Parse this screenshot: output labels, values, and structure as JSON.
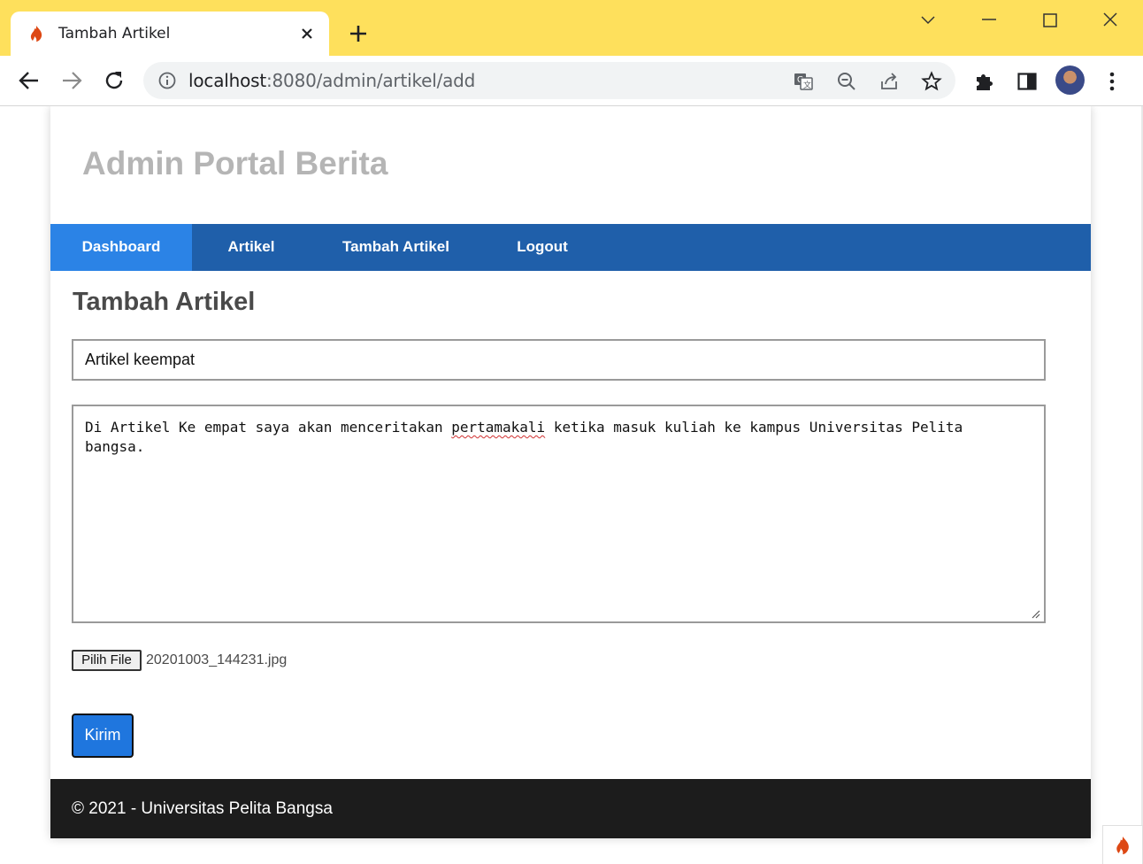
{
  "browser": {
    "tab_title": "Tambah Artikel",
    "url_host": "localhost",
    "url_path": ":8080/admin/artikel/add"
  },
  "site": {
    "title": "Admin Portal Berita",
    "nav": [
      {
        "label": "Dashboard",
        "active": true
      },
      {
        "label": "Artikel",
        "active": false
      },
      {
        "label": "Tambah Artikel",
        "active": false
      },
      {
        "label": "Logout",
        "active": false
      }
    ]
  },
  "form": {
    "heading": "Tambah Artikel",
    "judul_value": "Artikel keempat",
    "isi_before": "Di Artikel Ke empat saya akan menceritakan ",
    "isi_misspelled": "pertamakali",
    "isi_after": " ketika masuk kuliah ke kampus Universitas Pelita\nbangsa.",
    "file_button_label": "Pilih File",
    "file_name": "20201003_144231.jpg",
    "submit_label": "Kirim"
  },
  "footer": {
    "text": "© 2021 - Universitas Pelita Bangsa"
  },
  "colors": {
    "chrome_frame": "#fee05c",
    "nav_bg": "#1f5faa",
    "nav_active": "#2b83e6",
    "submit_bg": "#1f76de",
    "footer_bg": "#1c1c1c"
  },
  "icons": {
    "tab_favicon": "codeigniter-flame-icon",
    "new_tab": "plus-icon",
    "back": "arrow-left-icon",
    "forward": "arrow-right-icon",
    "reload": "reload-icon",
    "site_info": "info-icon",
    "translate": "translate-icon",
    "zoom": "zoom-out-icon",
    "share": "share-icon",
    "bookmark": "star-icon",
    "extensions": "puzzle-icon",
    "side_panel": "side-panel-icon",
    "menu": "kebab-menu-icon"
  }
}
